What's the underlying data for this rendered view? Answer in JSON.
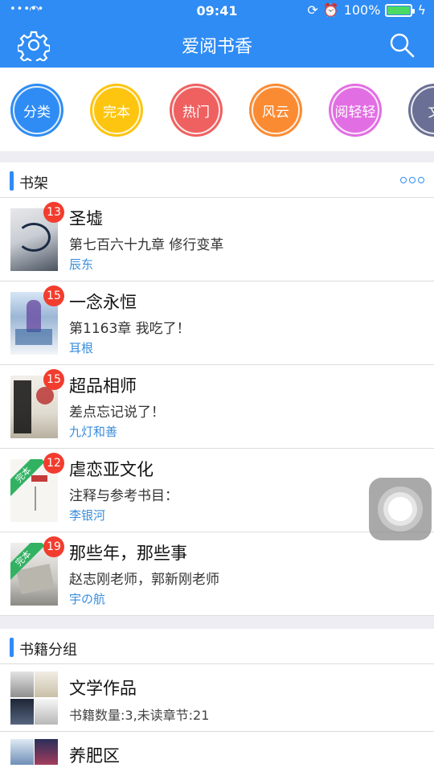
{
  "status_bar": {
    "signal": "•••••",
    "time": "09:41",
    "battery": "100%",
    "battery_level": 1.0
  },
  "nav": {
    "title": "爱阅书香"
  },
  "categories": [
    {
      "label": "分类",
      "color": "#2f8cf4"
    },
    {
      "label": "完本",
      "color": "#fdc510"
    },
    {
      "label": "热门",
      "color": "#ee6160"
    },
    {
      "label": "风云",
      "color": "#fb8b33"
    },
    {
      "label": "阅轻轻",
      "color": "#e26ee3"
    },
    {
      "label": "文",
      "color": "#6a7095"
    }
  ],
  "bookshelf": {
    "title": "书架",
    "books": [
      {
        "title": "圣墟",
        "chapter": "第七百六十九章 修行变革",
        "author": "辰东",
        "badge": "13",
        "ribbon": ""
      },
      {
        "title": "一念永恒",
        "chapter": "第1163章 我吃了！",
        "author": "耳根",
        "badge": "15",
        "ribbon": ""
      },
      {
        "title": "超品相师",
        "chapter": "差点忘记说了！",
        "author": "九灯和善",
        "badge": "15",
        "ribbon": ""
      },
      {
        "title": "虐恋亚文化",
        "chapter": "注释与参考书目：",
        "author": "李银河",
        "badge": "12",
        "ribbon": "完本"
      },
      {
        "title": "那些年，那些事",
        "chapter": "赵志刚老师，郭新刚老师",
        "author": "宇の航",
        "badge": "19",
        "ribbon": "完本"
      }
    ]
  },
  "groups": {
    "title": "书籍分组",
    "items": [
      {
        "title": "文学作品",
        "info": "书籍数量:3,未读章节:21"
      },
      {
        "title": "养肥区",
        "info": ""
      }
    ]
  }
}
